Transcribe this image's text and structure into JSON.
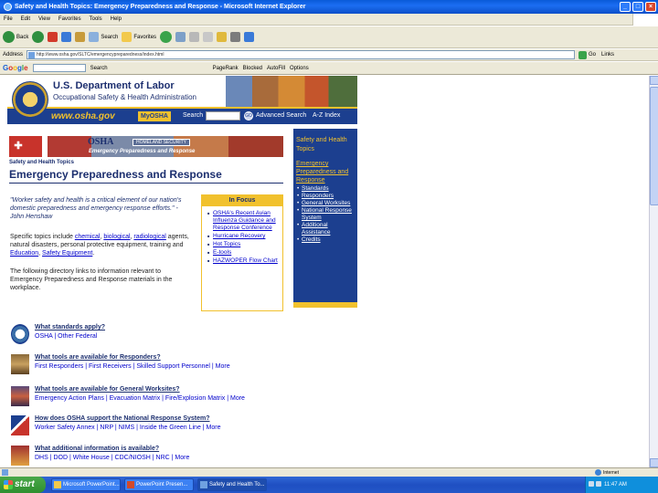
{
  "window": {
    "title": "Safety and Health Topics: Emergency Preparedness and Response - Microsoft Internet Explorer",
    "min": "_",
    "max": "□",
    "close": "×"
  },
  "menu": [
    "File",
    "Edit",
    "View",
    "Favorites",
    "Tools",
    "Help"
  ],
  "toolbar": {
    "back": "Back",
    "search": "Search",
    "favorites": "Favorites"
  },
  "address": {
    "label": "Address",
    "url": "http://www.osha.gov/SLTC/emergencypreparedness/index.html",
    "go": "Go",
    "links": "Links"
  },
  "google": {
    "search": "Search",
    "options": [
      "PageRank",
      "Blocked",
      "AutoFill",
      "Options"
    ]
  },
  "header": {
    "dept": "U.S. Department of Labor",
    "agency": "Occupational Safety & Health Administration",
    "url": "www.osha.gov",
    "myosha": "MyOSHA",
    "search_label": "Search",
    "go": "GO",
    "advanced": "Advanced Search",
    "az": "A-Z Index"
  },
  "banner": {
    "osha": "OSHA",
    "homeland": "HOMELAND SECURITY",
    "sub": "Emergency Preparedness and Response"
  },
  "page": {
    "crumb": "Safety and Health Topics",
    "title": "Emergency Preparedness and Response",
    "quote": "\"Worker safety and health is a critical element of our nation's domestic preparedness and emergency response efforts.\" - John Henshaw",
    "specific_prefix": "Specific topics include",
    "specific_links": [
      "chemical",
      "biological",
      "radiological"
    ],
    "specific_text": "agents, natural disasters, personal protective equipment, training and",
    "specific_links2": [
      "Education",
      "Safety Equipment"
    ],
    "following": "The following directory links to information relevant to Emergency Preparedness and Response materials in the workplace."
  },
  "infocus": {
    "heading": "In Focus",
    "items": [
      "OSHA's Recent Avian Influenza Guidance and Response Conference",
      "Hurricane Recovery",
      "Hot Topics",
      "E-tools",
      "HAZWOPER Flow Chart"
    ]
  },
  "rightnav": {
    "heading": "Safety and Health Topics",
    "current": "Emergency Preparedness and Response",
    "items": [
      "Standards",
      "Responders",
      "General Worksites",
      "National Response System",
      "Additional Assistance",
      "Credits"
    ]
  },
  "questions": [
    {
      "title": "What standards apply?",
      "links": "OSHA | Other Federal"
    },
    {
      "title": "What tools are available for Responders?",
      "links": "First Responders | First Receivers | Skilled Support Personnel | More"
    },
    {
      "title": "What tools are available for General Worksites?",
      "links": "Emergency Action Plans | Evacuation Matrix | Fire/Explosion Matrix | More"
    },
    {
      "title": "How does OSHA support the National Response System?",
      "links": "Worker Safety Annex | NRP | NIMS | Inside the Green Line | More"
    },
    {
      "title": "What additional information is available?",
      "links": "DHS | DOD | White House | CDC/NIOSH | NRC | More"
    }
  ],
  "status": {
    "zone": "Internet"
  },
  "taskbar": {
    "start": "start",
    "tasks": [
      "Microsoft PowerPoint...",
      "PowerPoint Presen...",
      "Safety and Health To..."
    ],
    "clock": "11:47 AM"
  },
  "colors": {
    "osha_blue": "#1c3f8f",
    "osha_gold": "#f1c12d",
    "link": "#0000cc"
  }
}
